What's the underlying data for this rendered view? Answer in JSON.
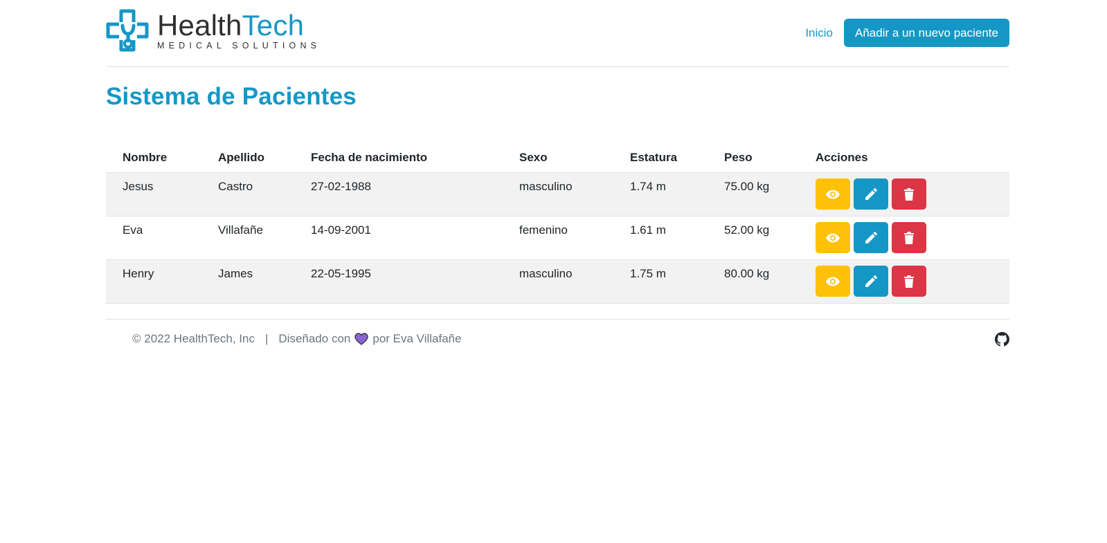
{
  "brand": {
    "name_part1": "Health",
    "name_part2": "Tech",
    "tagline": "MEDICAL SOLUTIONS",
    "color_primary": "#1597c6",
    "color_dark": "#2f2f2f"
  },
  "nav": {
    "home_label": "Inicio",
    "new_patient_label": "Añadir a un nuevo paciente"
  },
  "page": {
    "title": "Sistema de Pacientes"
  },
  "table": {
    "headers": [
      "Nombre",
      "Apellido",
      "Fecha de nacimiento",
      "Sexo",
      "Estatura",
      "Peso",
      "Acciones"
    ],
    "rows": [
      {
        "nombre": "Jesus",
        "apellido": "Castro",
        "fecha": "27-02-1988",
        "sexo": "masculino",
        "estatura": "1.74 m",
        "peso": "75.00 kg"
      },
      {
        "nombre": "Eva",
        "apellido": "Villafañe",
        "fecha": "14-09-2001",
        "sexo": "femenino",
        "estatura": "1.61 m",
        "peso": "52.00 kg"
      },
      {
        "nombre": "Henry",
        "apellido": "James",
        "fecha": "22-05-1995",
        "sexo": "masculino",
        "estatura": "1.75 m",
        "peso": "80.00 kg"
      }
    ],
    "action_icons": [
      "eye-icon",
      "pencil-icon",
      "trash-icon"
    ],
    "action_colors": {
      "view": "#ffc107",
      "edit": "#1597c6",
      "delete": "#dc3545"
    }
  },
  "footer": {
    "copyright": "© 2022 HealthTech, Inc",
    "separator": "|",
    "designed_prefix": "Diseñado con",
    "designed_suffix": "por Eva Villafañe",
    "heart_color": "#8a63d2",
    "github_icon": "github-icon"
  }
}
